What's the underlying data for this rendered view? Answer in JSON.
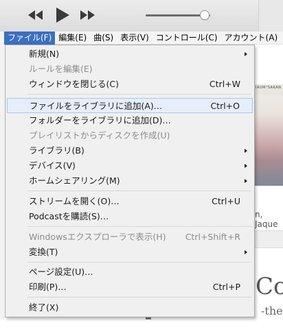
{
  "menubar": {
    "items": [
      {
        "label": "ファイル(F)"
      },
      {
        "label": "編集(E)"
      },
      {
        "label": "曲(S)"
      },
      {
        "label": "表示(V)"
      },
      {
        "label": "コントロール(C)"
      },
      {
        "label": "アカウント(A)"
      }
    ]
  },
  "transport": {
    "rewind_icon": "rewind-icon",
    "play_icon": "play-icon",
    "forward_icon": "fast-forward-icon",
    "volume_level": 0.92
  },
  "file_menu": {
    "items": [
      {
        "label": "新規(N)",
        "submenu": true
      },
      {
        "label": "ルールを編集(E)",
        "disabled": true
      },
      {
        "label": "ウィンドウを閉じる(C)",
        "shortcut": "Ctrl+W"
      },
      {
        "label": "ファイルをライブラリに追加(A)…",
        "shortcut": "Ctrl+O",
        "highlighted": true
      },
      {
        "label": "フォルダーをライブラリに追加(D)…"
      },
      {
        "label": "プレイリストからディスクを作成(U)",
        "disabled": true
      },
      {
        "label": "ライブラリ(B)",
        "submenu": true
      },
      {
        "label": "デバイス(V)",
        "submenu": true
      },
      {
        "label": "ホームシェアリング(M)",
        "submenu": true
      },
      {
        "label": "ストリームを開く(O)…",
        "shortcut": "Ctrl+U"
      },
      {
        "label": "Podcastを購読(S)…"
      },
      {
        "label": "Windowsエクスプローラで表示(H)",
        "shortcut": "Ctrl+Shift+R",
        "disabled": true
      },
      {
        "label": "変換(T)",
        "submenu": true
      },
      {
        "label": "ページ設定(U)…"
      },
      {
        "label": "印刷(P)…",
        "shortcut": "Ctrl+P"
      },
      {
        "label": "終了(X)"
      }
    ]
  },
  "background": {
    "album_header": "IAUM°SAKAN",
    "artist_fragment": "n, Jaque",
    "title_fragment": "Co",
    "subtitle_fragment": "-the"
  },
  "colors": {
    "menubar_active": "#3b6fc1",
    "menu_highlight": "#e5eef9",
    "menu_highlight_border": "#a8c6ec",
    "disabled_text": "#8d8d8d"
  }
}
